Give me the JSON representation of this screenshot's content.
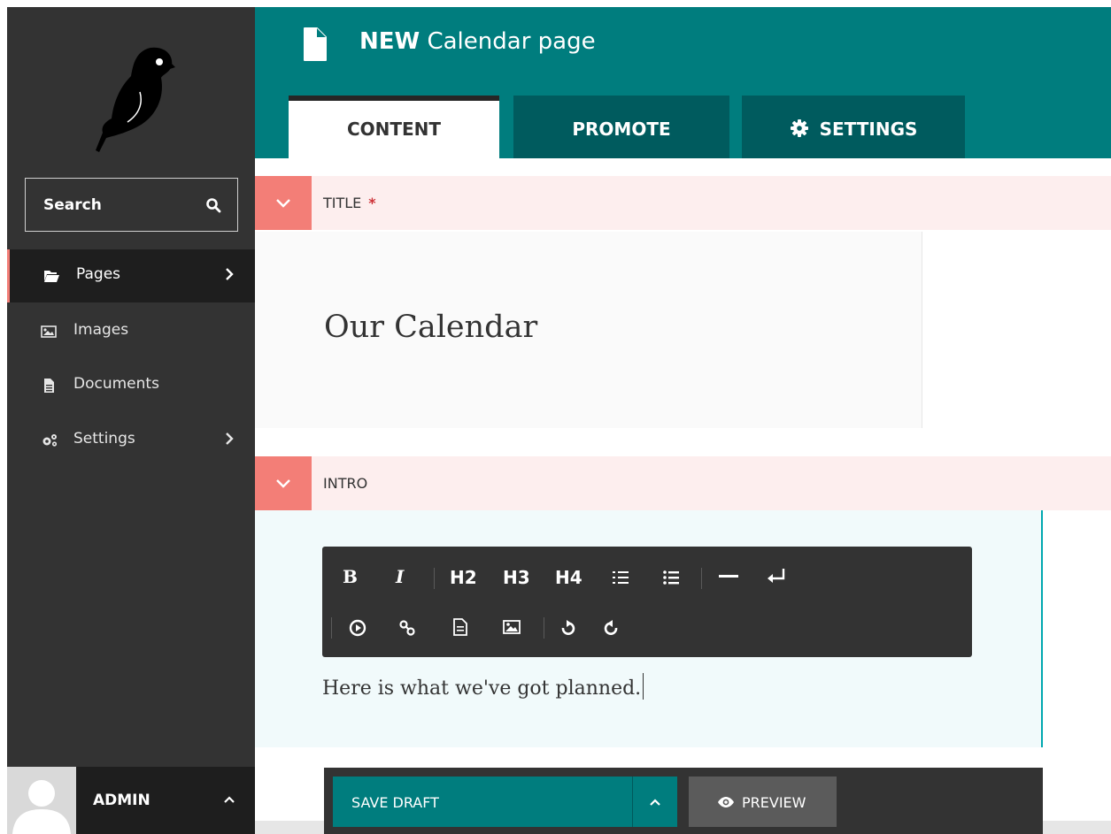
{
  "sidebar": {
    "logo": "wagtail-bird-logo",
    "search_label": "Search",
    "items": [
      {
        "label": "Pages",
        "icon": "folder-open-icon",
        "active": true,
        "has_submenu": true
      },
      {
        "label": "Images",
        "icon": "image-icon",
        "active": false,
        "has_submenu": false
      },
      {
        "label": "Documents",
        "icon": "document-icon",
        "active": false,
        "has_submenu": false
      },
      {
        "label": "Settings",
        "icon": "cogs-icon",
        "active": false,
        "has_submenu": true
      }
    ],
    "account": {
      "name": "ADMIN"
    }
  },
  "header": {
    "title_prefix": "NEW",
    "title": "Calendar page",
    "tabs": [
      {
        "label": "CONTENT",
        "active": true
      },
      {
        "label": "PROMOTE",
        "active": false
      },
      {
        "label": "SETTINGS",
        "active": false,
        "icon": "gear-icon"
      }
    ]
  },
  "fields": {
    "title": {
      "label": "TITLE",
      "required_mark": "*",
      "value": "Our Calendar"
    },
    "intro": {
      "label": "INTRO",
      "toolbar": {
        "bold": "B",
        "italic": "I",
        "h2": "H2",
        "h3": "H3",
        "h4": "H4"
      },
      "value": "Here is what we've got planned."
    }
  },
  "actions": {
    "save_label": "SAVE DRAFT",
    "preview_label": "PREVIEW"
  },
  "colors": {
    "sidebar": "#333333",
    "header": "#007d7e",
    "tab_inactive": "#005b5e",
    "field_toggle": "#f37e77",
    "field_header_bg": "#fdeeee",
    "intro_bg": "#f1fafb",
    "intro_accent": "#00a8b0"
  }
}
